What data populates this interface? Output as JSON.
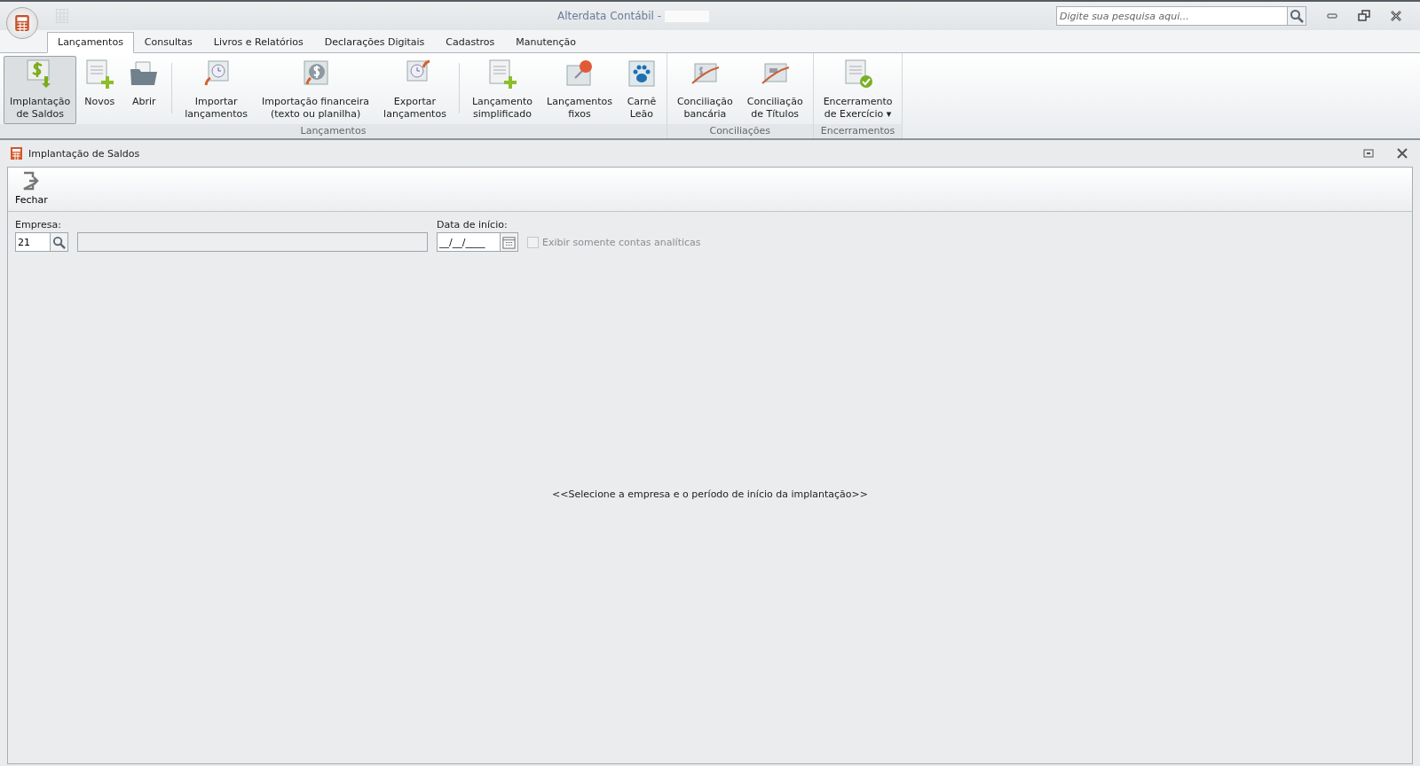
{
  "window": {
    "title": "Alterdata Contábil -",
    "search": {
      "placeholder": "Digite sua pesquisa aqui..."
    }
  },
  "tabs": [
    {
      "label": "Lançamentos",
      "selected": true
    },
    {
      "label": "Consultas",
      "selected": false
    },
    {
      "label": "Livros e Relatórios",
      "selected": false
    },
    {
      "label": "Declarações Digitais",
      "selected": false
    },
    {
      "label": "Cadastros",
      "selected": false
    },
    {
      "label": "Manutenção",
      "selected": false
    }
  ],
  "ribbon_groups": [
    {
      "label": "Lançamentos",
      "sets": [
        [
          {
            "lines": [
              "Implantação",
              "de Saldos"
            ],
            "kind": "dollar-arrow",
            "selected": true
          },
          {
            "lines": [
              "Novos"
            ],
            "kind": "doc-plus",
            "selected": false
          },
          {
            "lines": [
              "Abrir"
            ],
            "kind": "folder",
            "selected": false
          }
        ],
        [
          {
            "lines": [
              "Importar",
              "lançamentos"
            ],
            "kind": "clock-in",
            "selected": false
          },
          {
            "lines": [
              "Importação financeira",
              "(texto ou planilha)"
            ],
            "kind": "dollar-in",
            "selected": false
          },
          {
            "lines": [
              "Exportar",
              "lançamentos"
            ],
            "kind": "clock-out",
            "selected": false
          }
        ],
        [
          {
            "lines": [
              "Lançamento",
              "simplificado"
            ],
            "kind": "doc-plus",
            "selected": false
          },
          {
            "lines": [
              "Lançamentos",
              "fixos"
            ],
            "kind": "pin",
            "selected": false
          },
          {
            "lines": [
              "Carnê",
              "Leão"
            ],
            "kind": "paw",
            "selected": false
          }
        ]
      ]
    },
    {
      "label": "Conciliações",
      "sets": [
        [
          {
            "lines": [
              "Conciliação",
              "bancária"
            ],
            "kind": "dollar-orbit",
            "selected": false
          },
          {
            "lines": [
              "Conciliação",
              "de Títulos"
            ],
            "kind": "card-orbit",
            "selected": false
          }
        ]
      ]
    },
    {
      "label": "Encerramentos",
      "sets": [
        [
          {
            "lines": [
              "Encerramento",
              "de Exercício ▾"
            ],
            "kind": "doc-check",
            "selected": false
          }
        ]
      ]
    }
  ],
  "document": {
    "title": "Implantação de Saldos",
    "toolbar": [
      {
        "label": "Fechar"
      }
    ],
    "company": {
      "label": "Empresa:",
      "value": "21"
    },
    "start_date": {
      "label": "Data de início:",
      "value": "__/__/____"
    },
    "analytic_only": {
      "label": "Exibir somente contas analíticas",
      "checked": false,
      "disabled": true
    },
    "message": "<<Selecione a empresa e o período de início da implantação>>"
  }
}
